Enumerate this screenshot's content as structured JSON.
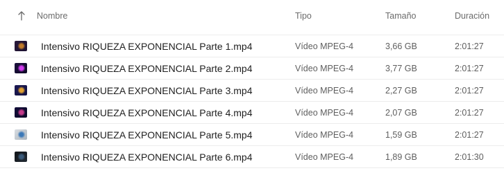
{
  "columns": {
    "name": "Nombre",
    "type": "Tipo",
    "size": "Tamaño",
    "duration": "Duración"
  },
  "sort": {
    "icon": "arrow-up-icon",
    "direction": "ascending"
  },
  "rows": [
    {
      "name": "Intensivo RIQUEZA EXPONENCIAL Parte 1.mp4",
      "type": "Vídeo MPEG-4",
      "size": "3,66 GB",
      "duration": "2:01:27",
      "thumb_colors": [
        "#2a1a3a",
        "#c07a2a",
        "#1b1030"
      ]
    },
    {
      "name": "Intensivo RIQUEZA EXPONENCIAL Parte 2.mp4",
      "type": "Vídeo MPEG-4",
      "size": "3,77 GB",
      "duration": "2:01:27",
      "thumb_colors": [
        "#1b0f3d",
        "#d23cf0",
        "#0f0a25"
      ]
    },
    {
      "name": "Intensivo RIQUEZA EXPONENCIAL Parte 3.mp4",
      "type": "Vídeo MPEG-4",
      "size": "2,27 GB",
      "duration": "2:01:27",
      "thumb_colors": [
        "#1c1a55",
        "#e0a030",
        "#14123e"
      ]
    },
    {
      "name": "Intensivo RIQUEZA EXPONENCIAL Parte 4.mp4",
      "type": "Vídeo MPEG-4",
      "size": "2,07 GB",
      "duration": "2:01:27",
      "thumb_colors": [
        "#120d3a",
        "#c43a8a",
        "#0b0826"
      ]
    },
    {
      "name": "Intensivo RIQUEZA EXPONENCIAL Parte 5.mp4",
      "type": "Vídeo MPEG-4",
      "size": "1,59 GB",
      "duration": "2:01:27",
      "thumb_colors": [
        "#d9dde2",
        "#3a78b8",
        "#a9b3bc"
      ]
    },
    {
      "name": "Intensivo RIQUEZA EXPONENCIAL Parte 6.mp4",
      "type": "Vídeo MPEG-4",
      "size": "1,89 GB",
      "duration": "2:01:30",
      "thumb_colors": [
        "#111418",
        "#3a5a7a",
        "#222a33"
      ]
    }
  ]
}
